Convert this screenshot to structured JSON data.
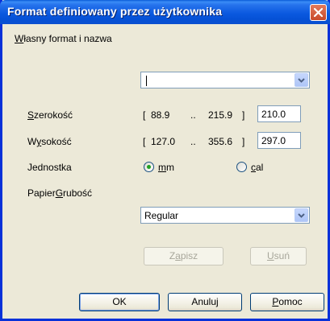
{
  "window": {
    "title": "Format definiowany przez użytkownika"
  },
  "section_label": {
    "u": "W",
    "rest": "łasny format i nazwa"
  },
  "name_combo": {
    "value": ""
  },
  "width": {
    "label_u": "S",
    "label_rest": "zerokość",
    "range_open": "[",
    "min": "88.9",
    "sep": "..",
    "max": "215.9",
    "range_close": "]",
    "value": "210.0"
  },
  "height": {
    "label_pre": "W",
    "label_u": "y",
    "label_rest": "sokość",
    "range_open": "[",
    "min": "127.0",
    "sep": "..",
    "max": "355.6",
    "range_close": "]",
    "value": "297.0"
  },
  "unit": {
    "label": "Jednostka",
    "mm_u": "m",
    "mm_rest": "m",
    "cal_u": "c",
    "cal_rest": "al",
    "selected": "mm"
  },
  "paper": {
    "label_pre": "Papier",
    "label_u": "G",
    "label_rest": "rubość",
    "value": "Regular"
  },
  "buttons": {
    "save_pre": "Z",
    "save_u": "a",
    "save_rest": "pisz",
    "delete_u": "U",
    "delete_rest": "suń",
    "ok": "OK",
    "cancel": "Anuluj",
    "help_u": "P",
    "help_rest": "omoc"
  },
  "colors": {
    "title_bar": "#0a5bd8",
    "dialog_bg": "#ece9d8",
    "close": "#c8492a",
    "radio_dot": "#21a121"
  }
}
